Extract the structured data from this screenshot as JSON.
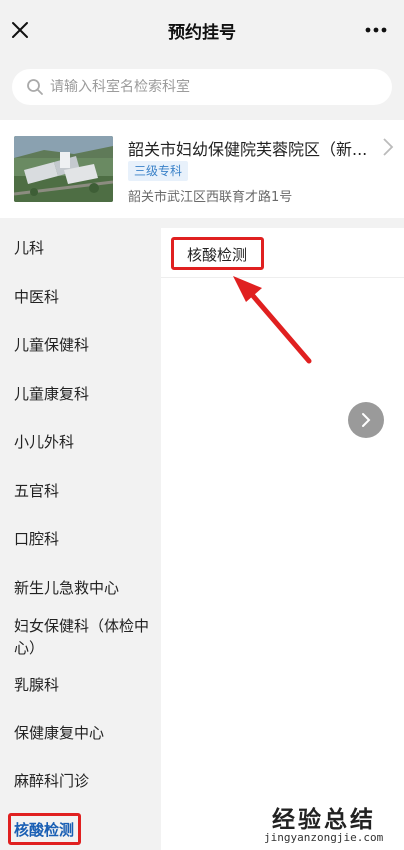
{
  "header": {
    "title": "预约挂号",
    "close_icon": "close-icon",
    "more_icon": "more-icon"
  },
  "search": {
    "placeholder": "请输入科室名检索科室",
    "value": ""
  },
  "hospital": {
    "name": "韶关市妇幼保健院芙蓉院区（新...",
    "level": "三级专科",
    "address": "韶关市武江区西联育才路1号"
  },
  "departments": [
    {
      "label": "儿科"
    },
    {
      "label": "中医科"
    },
    {
      "label": "儿童保健科"
    },
    {
      "label": "儿童康复科"
    },
    {
      "label": "小儿外科"
    },
    {
      "label": "五官科"
    },
    {
      "label": "口腔科"
    },
    {
      "label": "新生儿急救中心"
    },
    {
      "label": "妇女保健科（体检中心）"
    },
    {
      "label": "乳腺科"
    },
    {
      "label": "保健康复中心"
    },
    {
      "label": "麻醉科门诊"
    },
    {
      "label": "核酸检测",
      "active": true
    }
  ],
  "sub_departments": [
    {
      "label": "核酸检测"
    }
  ],
  "watermark": {
    "title": "经验总结",
    "url": "jingyanzongjie.com"
  },
  "colors": {
    "accent": "#1a5fb4",
    "highlight": "#e02020",
    "badge_bg": "#e8f1fb",
    "badge_text": "#3b82c8"
  }
}
